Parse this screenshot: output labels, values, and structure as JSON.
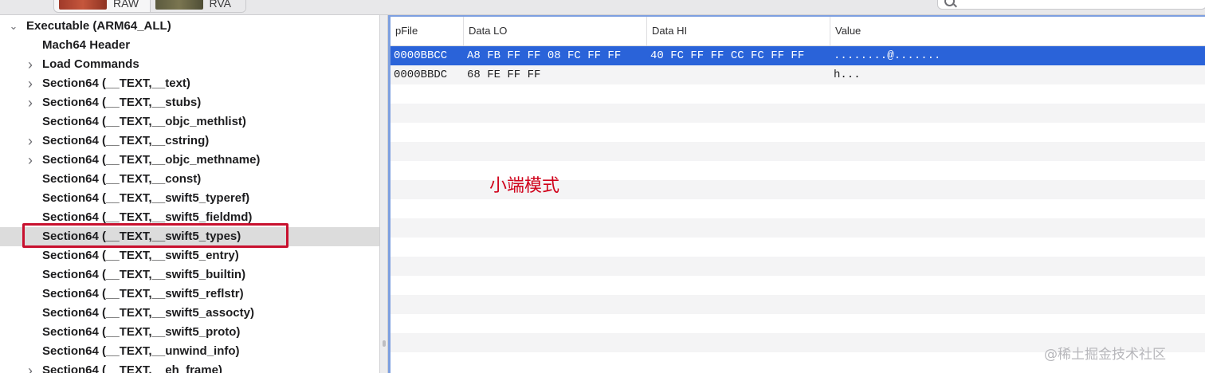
{
  "toolbar": {
    "segments": [
      {
        "label": "RAW",
        "icon": "raw-thumbnail"
      },
      {
        "label": "RVA",
        "icon": "rva-thumbnail"
      }
    ],
    "search_icon": "search-icon"
  },
  "tree": {
    "root": "Executable  (ARM64_ALL)",
    "items": [
      {
        "label": "Mach64 Header",
        "expandable": false
      },
      {
        "label": "Load Commands",
        "expandable": true
      },
      {
        "label": "Section64 (__TEXT,__text)",
        "expandable": true
      },
      {
        "label": "Section64 (__TEXT,__stubs)",
        "expandable": true
      },
      {
        "label": "Section64 (__TEXT,__objc_methlist)",
        "expandable": false
      },
      {
        "label": "Section64 (__TEXT,__cstring)",
        "expandable": true
      },
      {
        "label": "Section64 (__TEXT,__objc_methname)",
        "expandable": true
      },
      {
        "label": "Section64 (__TEXT,__const)",
        "expandable": false
      },
      {
        "label": "Section64 (__TEXT,__swift5_typeref)",
        "expandable": false
      },
      {
        "label": "Section64 (__TEXT,__swift5_fieldmd)",
        "expandable": false
      },
      {
        "label": "Section64 (__TEXT,__swift5_types)",
        "expandable": false,
        "selected": true
      },
      {
        "label": "Section64 (__TEXT,__swift5_entry)",
        "expandable": false
      },
      {
        "label": "Section64 (__TEXT,__swift5_builtin)",
        "expandable": false
      },
      {
        "label": "Section64 (__TEXT,__swift5_reflstr)",
        "expandable": false
      },
      {
        "label": "Section64 (__TEXT,__swift5_assocty)",
        "expandable": false
      },
      {
        "label": "Section64 (__TEXT,__swift5_proto)",
        "expandable": false
      },
      {
        "label": "Section64 (__TEXT,__unwind_info)",
        "expandable": false
      },
      {
        "label": "Section64 (__TEXT,__eh_frame)",
        "expandable": true
      }
    ]
  },
  "table": {
    "columns": [
      "pFile",
      "Data LO",
      "Data HI",
      "Value"
    ],
    "rows": [
      {
        "pfile": "0000BBCC",
        "data_lo": "A8 FB FF FF 08 FC FF FF",
        "data_hi": "40 FC FF FF CC FC FF FF",
        "value": "........@.......",
        "selected": true
      },
      {
        "pfile": "0000BBDC",
        "data_lo": "68 FE FF FF",
        "data_hi": "",
        "value": "h...",
        "selected": false
      }
    ]
  },
  "annotation": "小端模式",
  "watermark": "@稀土掘金技术社区",
  "colors": {
    "selection": "#2a63d9",
    "highlight_box": "#c8102e",
    "annotation": "#d0021b"
  }
}
